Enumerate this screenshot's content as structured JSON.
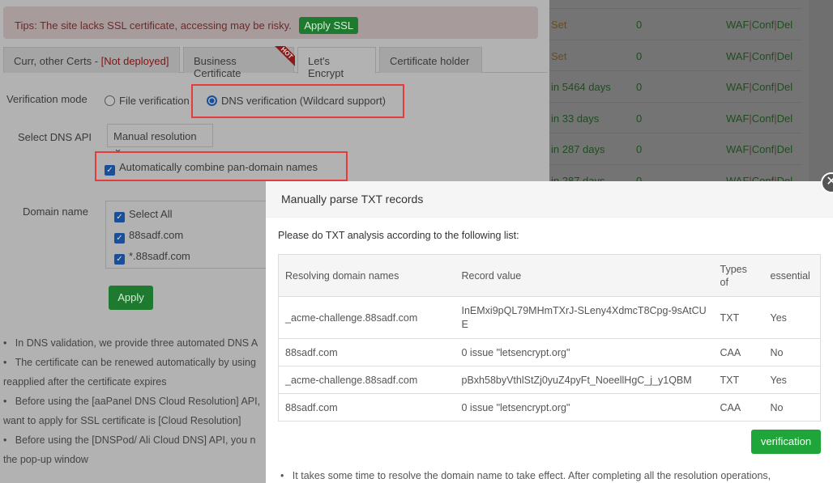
{
  "tips": {
    "text": "Tips: The site lacks SSL certificate, accessing may be risky.",
    "apply_ssl": "Apply SSL"
  },
  "tabs": [
    {
      "label": "Curr, other Certs - ",
      "status": "[Not deployed]"
    },
    {
      "label": "Business Certificate",
      "badge": "HOT"
    },
    {
      "label": "Let's Encrypt"
    },
    {
      "label": "Certificate holder"
    }
  ],
  "form": {
    "verification_mode_label": "Verification mode",
    "file_verification": "File verification",
    "dns_verification": "DNS verification (Wildcard support)",
    "dns_api_label": "Select DNS API",
    "dns_api_value": "Manual resolution",
    "auto_combine": "Automatically combine pan-domain names",
    "domain_label": "Domain name",
    "domains": [
      "Select All",
      "88sadf.com",
      "*.88sadf.com"
    ],
    "apply": "Apply"
  },
  "notes": [
    "In DNS validation, we provide three automated DNS A",
    "The certificate can be renewed automatically by using",
    "reapplied after the certificate expires",
    "Before using the [aaPanel DNS Cloud Resolution] API,",
    "want to apply for SSL certificate is [Cloud Resolution]",
    "Before using the [DNSPod/ Ali Cloud DNS] API, you n",
    "the pop-up window"
  ],
  "bg_table": [
    {
      "ssl": "Set",
      "num": "0"
    },
    {
      "ssl": "Set",
      "num": "0"
    },
    {
      "ssl": "in 5464 days",
      "num": "0"
    },
    {
      "ssl": "in 33 days",
      "num": "0"
    },
    {
      "ssl": "in 287 days",
      "num": "0"
    },
    {
      "ssl": "in 287 days",
      "num": "0"
    }
  ],
  "bg_actions": {
    "waf": "WAF",
    "conf": "Conf",
    "del": "Del",
    "sep": "|"
  },
  "modal": {
    "title": "Manually parse TXT records",
    "intro": "Please do TXT analysis according to the following list:",
    "headers": [
      "Resolving domain names",
      "Record value",
      "Types of",
      "essential"
    ],
    "rows": [
      [
        "_acme-challenge.88sadf.com",
        "InEMxi9pQL79MHmTXrJ-SLeny4XdmcT8Cpg-9sAtCUE",
        "TXT",
        "Yes"
      ],
      [
        "88sadf.com",
        "0 issue \"letsencrypt.org\"",
        "CAA",
        "No"
      ],
      [
        "_acme-challenge.88sadf.com",
        "pBxh58byVthlStZj0yuZ4pyFt_NoeellHgC_j_y1QBM",
        "TXT",
        "Yes"
      ],
      [
        "88sadf.com",
        "0 issue \"letsencrypt.org\"",
        "CAA",
        "No"
      ]
    ],
    "verify": "verification",
    "note": "It takes some time to resolve the domain name to take effect. After completing all the resolution operations,"
  }
}
